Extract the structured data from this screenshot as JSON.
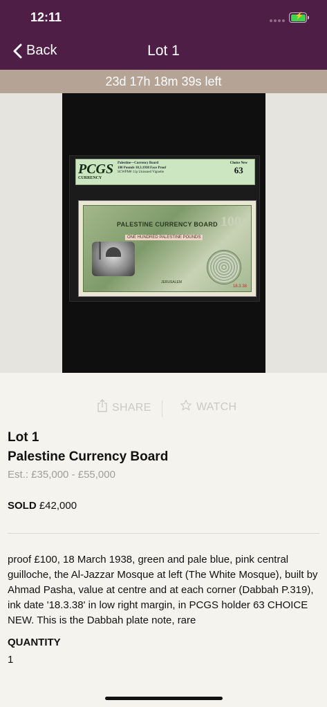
{
  "status_bar": {
    "time": "12:11"
  },
  "nav": {
    "back_label": "Back",
    "title": "Lot 1"
  },
  "timer": {
    "text": "23d 17h 18m 39s left"
  },
  "image": {
    "slab": {
      "brand": "PCGS",
      "brand_sub": "CURRENCY",
      "line1": "Palestine—Currency Board",
      "line2": "100 Pounds 18.3.1938 Face Proof",
      "line3": "SCWPM# 11p    Unissued Vignette",
      "grade_label": "Choice New",
      "grade": "63"
    },
    "note": {
      "title": "PALESTINE CURRENCY BOARD",
      "denomination": "100",
      "subtitle": "ONE HUNDRED PALESTINE POUNDS",
      "city": "JERUSALEM",
      "date": "18.3.38"
    }
  },
  "actions": {
    "share_label": "SHARE",
    "watch_label": "WATCH"
  },
  "lot": {
    "number_label": "Lot 1",
    "title": "Palestine Currency Board",
    "estimate": "Est.: £35,000 - £55,000",
    "sold_label": "SOLD",
    "sold_price": "£42,000",
    "description": "proof £100, 18 March 1938, green and pale blue, pink central guilloche, the Al-Jazzar Mosque at left (The White Mosque), built by Ahmad Pasha, value at centre and at each corner (Dabbah P.319), ink date '18.3.38' in low right margin, in PCGS holder 63 CHOICE NEW. This is the Dabbah plate note, rare",
    "quantity_label": "QUANTITY",
    "quantity": "1"
  },
  "colors": {
    "header": "#4e1e46",
    "timer_bar": "#b5a396",
    "background": "#f4f3ee",
    "battery": "#3fd24a"
  },
  "icons": {
    "back": "chevron-left-icon",
    "share": "share-icon",
    "watch": "star-icon",
    "battery": "battery-charging-icon"
  }
}
